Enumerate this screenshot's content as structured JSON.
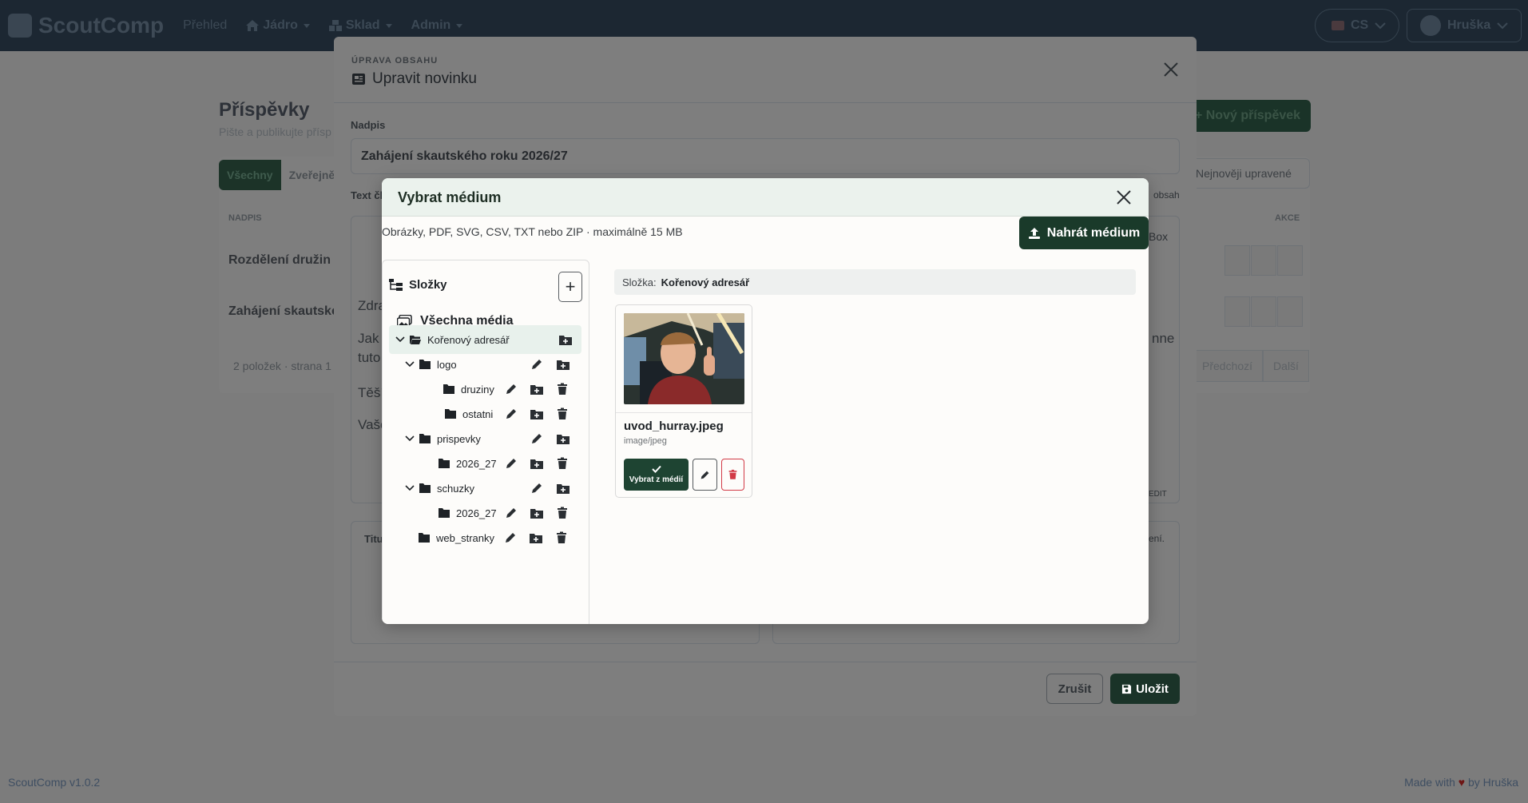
{
  "navbar": {
    "brand": "ScoutComp",
    "items": [
      {
        "label": "Přehled"
      },
      {
        "label": "Jádro"
      },
      {
        "label": "Sklad"
      },
      {
        "label": "Admin"
      }
    ],
    "language": "CS",
    "user": "Hruška"
  },
  "background_page": {
    "title": "Příspěvky",
    "subtitle": "Pište a publikujte přísp",
    "new_post": "Nový příspěvek",
    "tabs": [
      "Všechny",
      "Zveřejněné"
    ],
    "sort": "Nejnověji upravené",
    "column_title": "NADPIS",
    "column_actions": "AKCE",
    "rows": [
      "Rozdělení družin v",
      "Zahájení skautské"
    ],
    "footer": "2 položek · strana 1",
    "pager": [
      "Předchozí",
      "Další"
    ]
  },
  "edit_modal": {
    "kicker": "ÚPRAVA OBSAHU",
    "title": "Upravit novinku",
    "heading_label": "Nadpis",
    "heading_value": "Zahájení skautského roku 2026/27",
    "text_label": "Text čl",
    "editor_fragments": [
      "Zdra",
      "Jak t",
      "tuto",
      "Těší",
      "Vaše",
      "nne",
      "Box",
      "obsah",
      "EDIT"
    ],
    "bottom_left_label": "Titu",
    "bottom_right_hint": "šení.",
    "cancel": "Zrušit",
    "save": "Uložit"
  },
  "media_picker": {
    "title": "Vybrat médium",
    "hint": "Obrázky, PDF, SVG, CSV, TXT nebo ZIP · maximálně 15 MB",
    "upload": "Nahrát médium",
    "folders_header": "Složky",
    "all_media": "Všechna média",
    "tree": [
      {
        "name": "Kořenový adresář",
        "expanded": true,
        "active": true
      },
      {
        "name": "logo",
        "expanded": true
      },
      {
        "name": "druziny"
      },
      {
        "name": "ostatni"
      },
      {
        "name": "prispevky",
        "expanded": true
      },
      {
        "name": "2026_27"
      },
      {
        "name": "schuzky",
        "expanded": true
      },
      {
        "name": "2026_27"
      },
      {
        "name": "web_stranky"
      }
    ],
    "breadcrumb_label": "Složka:",
    "breadcrumb_value": "Kořenový adresář",
    "files": [
      {
        "name": "uvod_hurray.jpeg",
        "type": "image/jpeg",
        "select_label": "Vybrat z médií"
      }
    ]
  },
  "footer": {
    "version": "ScoutComp v1.0.2",
    "made_with": "Made with",
    "by": "by Hruška"
  },
  "colors": {
    "primary": "#1a3a2a",
    "danger": "#d23a46",
    "navbar": "#1c2732",
    "overlay": "#7c7c7c"
  }
}
